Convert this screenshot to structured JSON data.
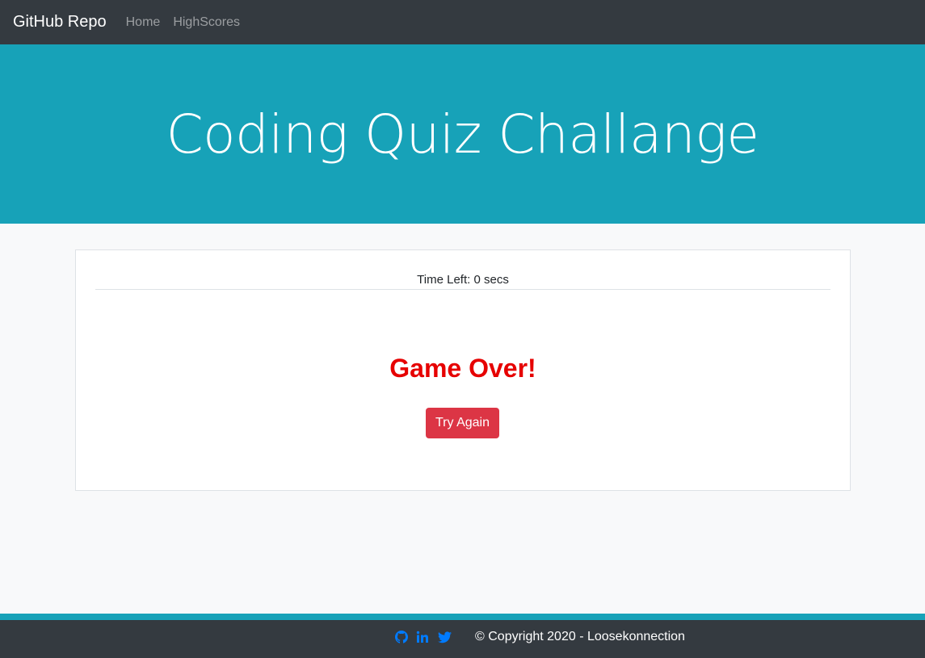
{
  "navbar": {
    "brand": "GitHub Repo",
    "links": [
      {
        "label": "Home"
      },
      {
        "label": "HighScores"
      }
    ]
  },
  "header": {
    "title": "Coding Quiz Challange"
  },
  "quiz": {
    "timer_text": "Time Left: 0 secs",
    "status": "Game Over!",
    "retry_label": "Try Again"
  },
  "footer": {
    "social_icons": [
      "github-icon",
      "linkedin-icon",
      "twitter-icon"
    ],
    "copyright": "© Copyright 2020 - Loosekonnection"
  },
  "colors": {
    "navbar": "#343a40",
    "accent": "#17a2b8",
    "danger": "#dc3545",
    "game_over_text": "#e60000",
    "social_icon": "#007bff"
  }
}
